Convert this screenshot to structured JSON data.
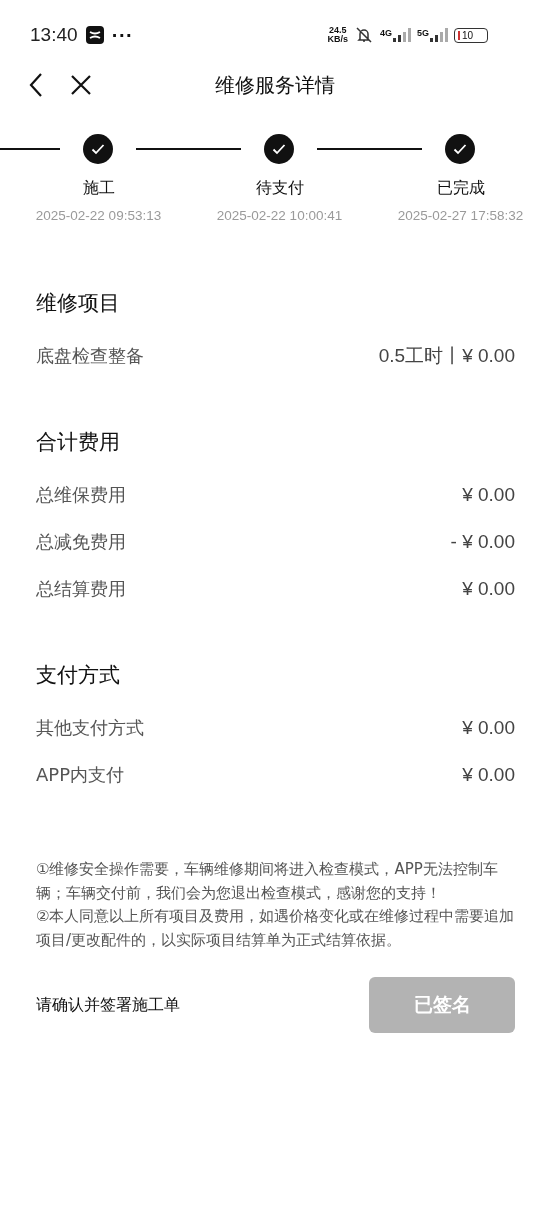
{
  "status_bar": {
    "time": "13:40",
    "more": "···",
    "speed": "24.5",
    "speed_unit": "KB/s",
    "net_1": "4G",
    "net_2": "5G",
    "battery": "10"
  },
  "nav": {
    "title": "维修服务详情"
  },
  "steps": [
    {
      "label": "施工",
      "time": "2025-02-22 09:53:13",
      "done": true
    },
    {
      "label": "待支付",
      "time": "2025-02-22 10:00:41",
      "done": true
    },
    {
      "label": "已完成",
      "time": "2025-02-27 17:58:32",
      "done": true
    }
  ],
  "sections": [
    {
      "title": "维修项目",
      "rows": [
        {
          "label": "底盘检查整备",
          "value": "0.5工时丨¥ 0.00"
        }
      ]
    },
    {
      "title": "合计费用",
      "rows": [
        {
          "label": "总维保费用",
          "value": "¥ 0.00"
        },
        {
          "label": "总减免费用",
          "value": "- ¥ 0.00"
        },
        {
          "label": "总结算费用",
          "value": "¥ 0.00"
        }
      ]
    },
    {
      "title": "支付方式",
      "rows": [
        {
          "label": "其他支付方式",
          "value": "¥ 0.00"
        },
        {
          "label": "APP内支付",
          "value": "¥ 0.00"
        }
      ]
    }
  ],
  "notes": [
    "①维修安全操作需要，车辆维修期间将进入检查模式，APP无法控制车辆；车辆交付前，我们会为您退出检查模式，感谢您的支持！",
    "②本人同意以上所有项目及费用，如遇价格变化或在维修过程中需要追加项目/更改配件的，以实际项目结算单为正式结算依据。"
  ],
  "sign": {
    "prompt": "请确认并签署施工单",
    "button": "已签名",
    "disabled": true
  }
}
